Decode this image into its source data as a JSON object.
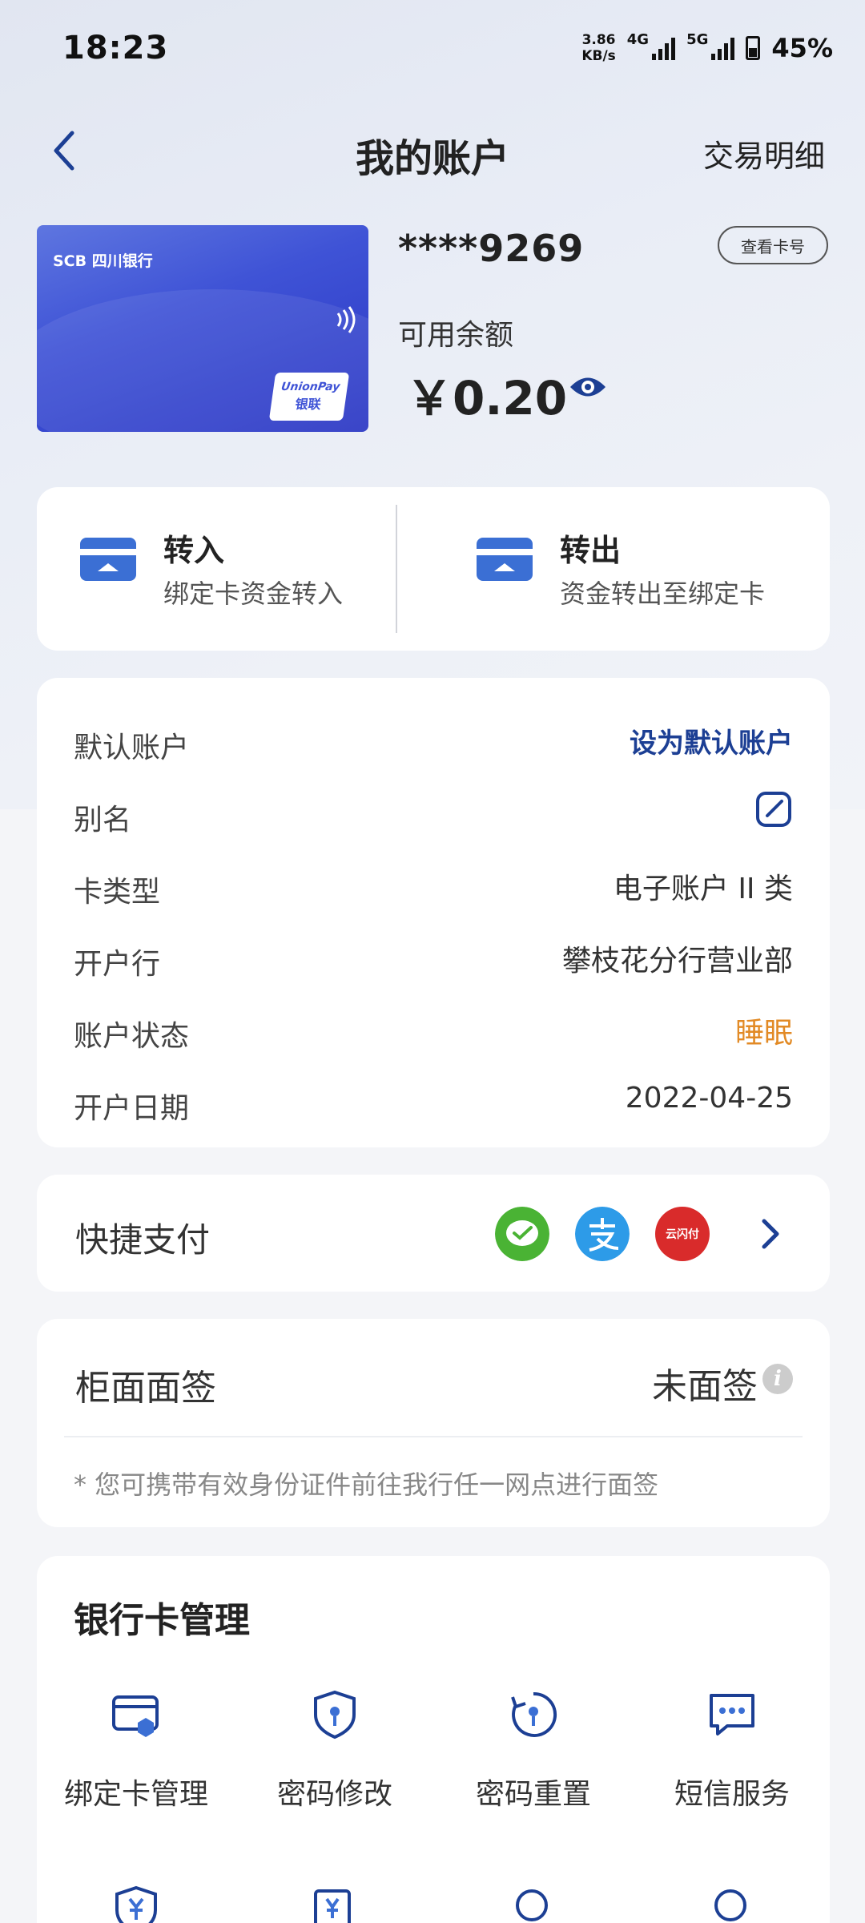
{
  "status_bar": {
    "time": "18:23",
    "net_speed_value": "3.86",
    "net_speed_unit": "KB/s",
    "sim1": "4G",
    "sim2": "5G",
    "battery": "45%"
  },
  "header": {
    "title": "我的账户",
    "right_link": "交易明细"
  },
  "card": {
    "bank_brand": "SCB 四川银行",
    "union_pay_en": "UnionPay",
    "union_pay_cn": "银联",
    "number_masked": "****9269",
    "view_number_button": "查看卡号",
    "balance_label": "可用余额",
    "balance_amount": "￥0.20"
  },
  "transfer": {
    "in_title": "转入",
    "in_desc": "绑定卡资金转入",
    "out_title": "转出",
    "out_desc": "资金转出至绑定卡"
  },
  "account_info": {
    "default_label": "默认账户",
    "default_action": "设为默认账户",
    "alias_label": "别名",
    "card_type_label": "卡类型",
    "card_type_value": "电子账户 II 类",
    "branch_label": "开户行",
    "branch_value": "攀枝花分行营业部",
    "status_label": "账户状态",
    "status_value": "睡眠",
    "open_date_label": "开户日期",
    "open_date_value": "2022-04-25",
    "status_color": "#e28a25",
    "link_color": "#1c3f94"
  },
  "quick_pay": {
    "label": "快捷支付",
    "logos": [
      "wechat-pay-icon",
      "alipay-icon",
      "cloud-quickpass-icon"
    ],
    "cloud_pay_text": "云闪付"
  },
  "counter_sign": {
    "label": "柜面面签",
    "value": "未面签",
    "note": "* 您可携带有效身份证件前往我行任一网点进行面签"
  },
  "card_management": {
    "title": "银行卡管理",
    "items": [
      {
        "label": "绑定卡管理",
        "icon": "bound-card-icon"
      },
      {
        "label": "密码修改",
        "icon": "shield-key-icon"
      },
      {
        "label": "密码重置",
        "icon": "reset-key-icon"
      },
      {
        "label": "短信服务",
        "icon": "message-icon"
      }
    ],
    "row2_icons": [
      "shield-yuan-icon",
      "yuan-doc-icon",
      "search-icon",
      "search-icon"
    ]
  }
}
